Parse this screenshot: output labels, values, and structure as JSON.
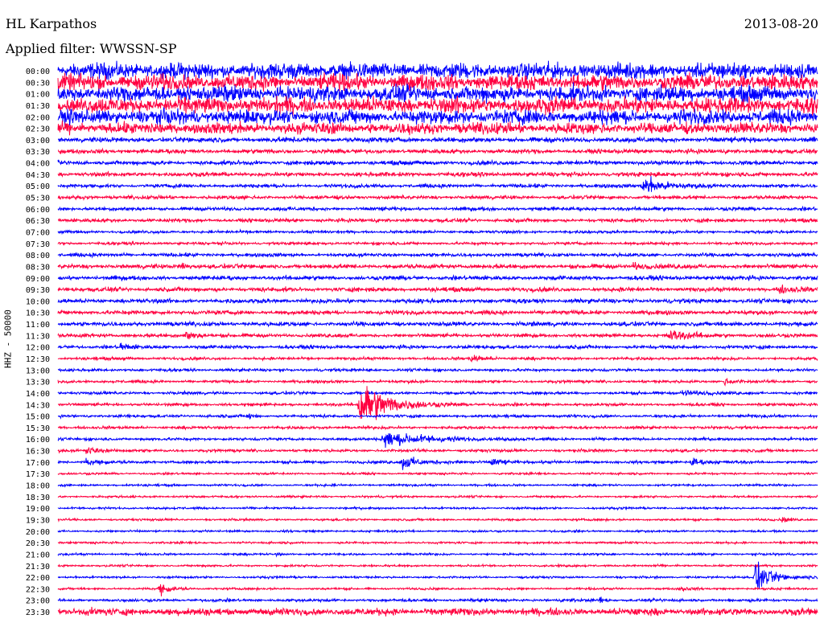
{
  "header": {
    "station": "HL Karpathos",
    "filter": "Applied filter: WWSSN-SP",
    "date": "2013-08-20"
  },
  "chart_data": {
    "type": "line",
    "title": "HL Karpathos",
    "subtitle": "Applied filter: WWSSN-SP",
    "ylabel": "HHZ - 50000",
    "xlabel": "",
    "minutes_per_line": 30,
    "colors": [
      "#0000ff",
      "#ff0040"
    ],
    "row_labels": [
      "00:00",
      "00:30",
      "01:00",
      "01:30",
      "02:00",
      "02:30",
      "03:00",
      "03:30",
      "04:00",
      "04:30",
      "05:00",
      "05:30",
      "06:00",
      "06:30",
      "07:00",
      "07:30",
      "08:00",
      "08:30",
      "09:00",
      "09:30",
      "10:00",
      "10:30",
      "11:00",
      "11:30",
      "12:00",
      "12:30",
      "13:00",
      "13:30",
      "14:00",
      "14:30",
      "15:00",
      "15:30",
      "16:00",
      "16:30",
      "17:00",
      "17:30",
      "18:00",
      "18:30",
      "19:00",
      "19:30",
      "20:00",
      "20:30",
      "21:00",
      "21:30",
      "22:00",
      "22:30",
      "23:00",
      "23:30"
    ],
    "noise_level": [
      11,
      11,
      11,
      11,
      10,
      8,
      3.5,
      3,
      3,
      3,
      2.5,
      2.5,
      2.5,
      2.5,
      2,
      2,
      2.5,
      3,
      3,
      3,
      3,
      3,
      3,
      2.5,
      2.5,
      2,
      2,
      2,
      2,
      2,
      2,
      2,
      2,
      2,
      2,
      1.5,
      1.5,
      1.5,
      1.5,
      1.5,
      1.5,
      1.5,
      1.5,
      1.5,
      1.5,
      1.5,
      2,
      5
    ],
    "events": [
      {
        "row": 10,
        "minute": 23.1,
        "amplitude": 16,
        "duration": 1.6
      },
      {
        "row": 17,
        "minute": 4.8,
        "amplitude": 5,
        "duration": 0.8
      },
      {
        "row": 17,
        "minute": 22.7,
        "amplitude": 5,
        "duration": 1.2
      },
      {
        "row": 19,
        "minute": 28.5,
        "amplitude": 5,
        "duration": 1.2
      },
      {
        "row": 23,
        "minute": 24.1,
        "amplitude": 9,
        "duration": 1.6
      },
      {
        "row": 23,
        "minute": 5.0,
        "amplitude": 7,
        "duration": 1.0
      },
      {
        "row": 24,
        "minute": 2.4,
        "amplitude": 8,
        "duration": 0.6
      },
      {
        "row": 25,
        "minute": 16.3,
        "amplitude": 6,
        "duration": 1.0
      },
      {
        "row": 27,
        "minute": 26.3,
        "amplitude": 6,
        "duration": 0.6
      },
      {
        "row": 28,
        "minute": 24.6,
        "amplitude": 6,
        "duration": 1.2
      },
      {
        "row": 29,
        "minute": 11.9,
        "amplitude": 45,
        "duration": 2.0
      },
      {
        "row": 30,
        "minute": 7.5,
        "amplitude": 8,
        "duration": 0.3
      },
      {
        "row": 32,
        "minute": 12.8,
        "amplitude": 14,
        "duration": 3.0
      },
      {
        "row": 33,
        "minute": 1.1,
        "amplitude": 8,
        "duration": 0.8
      },
      {
        "row": 34,
        "minute": 1.1,
        "amplitude": 6,
        "duration": 0.8
      },
      {
        "row": 34,
        "minute": 13.6,
        "amplitude": 12,
        "duration": 1.2
      },
      {
        "row": 34,
        "minute": 17.1,
        "amplitude": 7,
        "duration": 1.0
      },
      {
        "row": 34,
        "minute": 25.0,
        "amplitude": 8,
        "duration": 0.8
      },
      {
        "row": 39,
        "minute": 28.6,
        "amplitude": 4,
        "duration": 0.6
      },
      {
        "row": 42,
        "minute": 8.6,
        "amplitude": 3,
        "duration": 0.4
      },
      {
        "row": 44,
        "minute": 27.5,
        "amplitude": 28,
        "duration": 1.2
      },
      {
        "row": 45,
        "minute": 4.0,
        "amplitude": 10,
        "duration": 0.8
      },
      {
        "row": 45,
        "minute": 24.6,
        "amplitude": 6,
        "duration": 0.4
      },
      {
        "row": 46,
        "minute": 21.4,
        "amplitude": 5,
        "duration": 0.4
      }
    ]
  }
}
